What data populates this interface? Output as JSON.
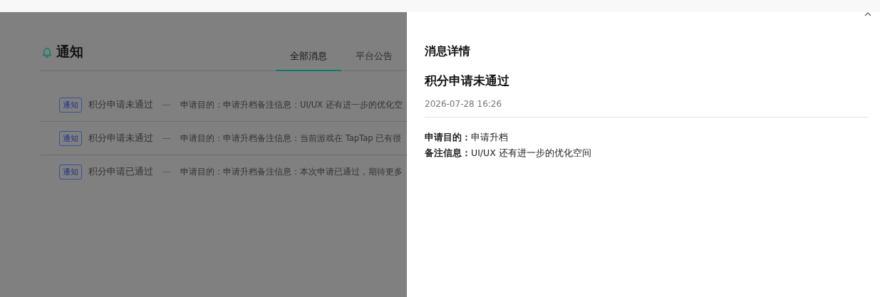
{
  "page": {
    "title": "通知",
    "tabs": [
      {
        "label": "全部消息",
        "selected": true
      },
      {
        "label": "平台公告",
        "selected": false
      }
    ],
    "notifications": [
      {
        "tag": "通知",
        "title": "积分申请未通过",
        "separator": "—",
        "summary": "申请目的：申请升档备注信息：UI/UX 还有进一步的优化空"
      },
      {
        "tag": "通知",
        "title": "积分申请未通过",
        "separator": "—",
        "summary": "申请目的：申请升档备注信息：当前游戏在 TapTap 已有很"
      },
      {
        "tag": "通知",
        "title": "积分申请已通过",
        "separator": "—",
        "summary": "申请目的：申请升档备注信息：本次申请已通过，期待更多"
      }
    ]
  },
  "drawer": {
    "heading": "消息详情",
    "title": "积分申请未通过",
    "time": "2026-07-28 16:26",
    "fields": [
      "**申请目的：**申请升档",
      "**备注信息：**UI/UX 还有进一步的优化空间"
    ]
  }
}
